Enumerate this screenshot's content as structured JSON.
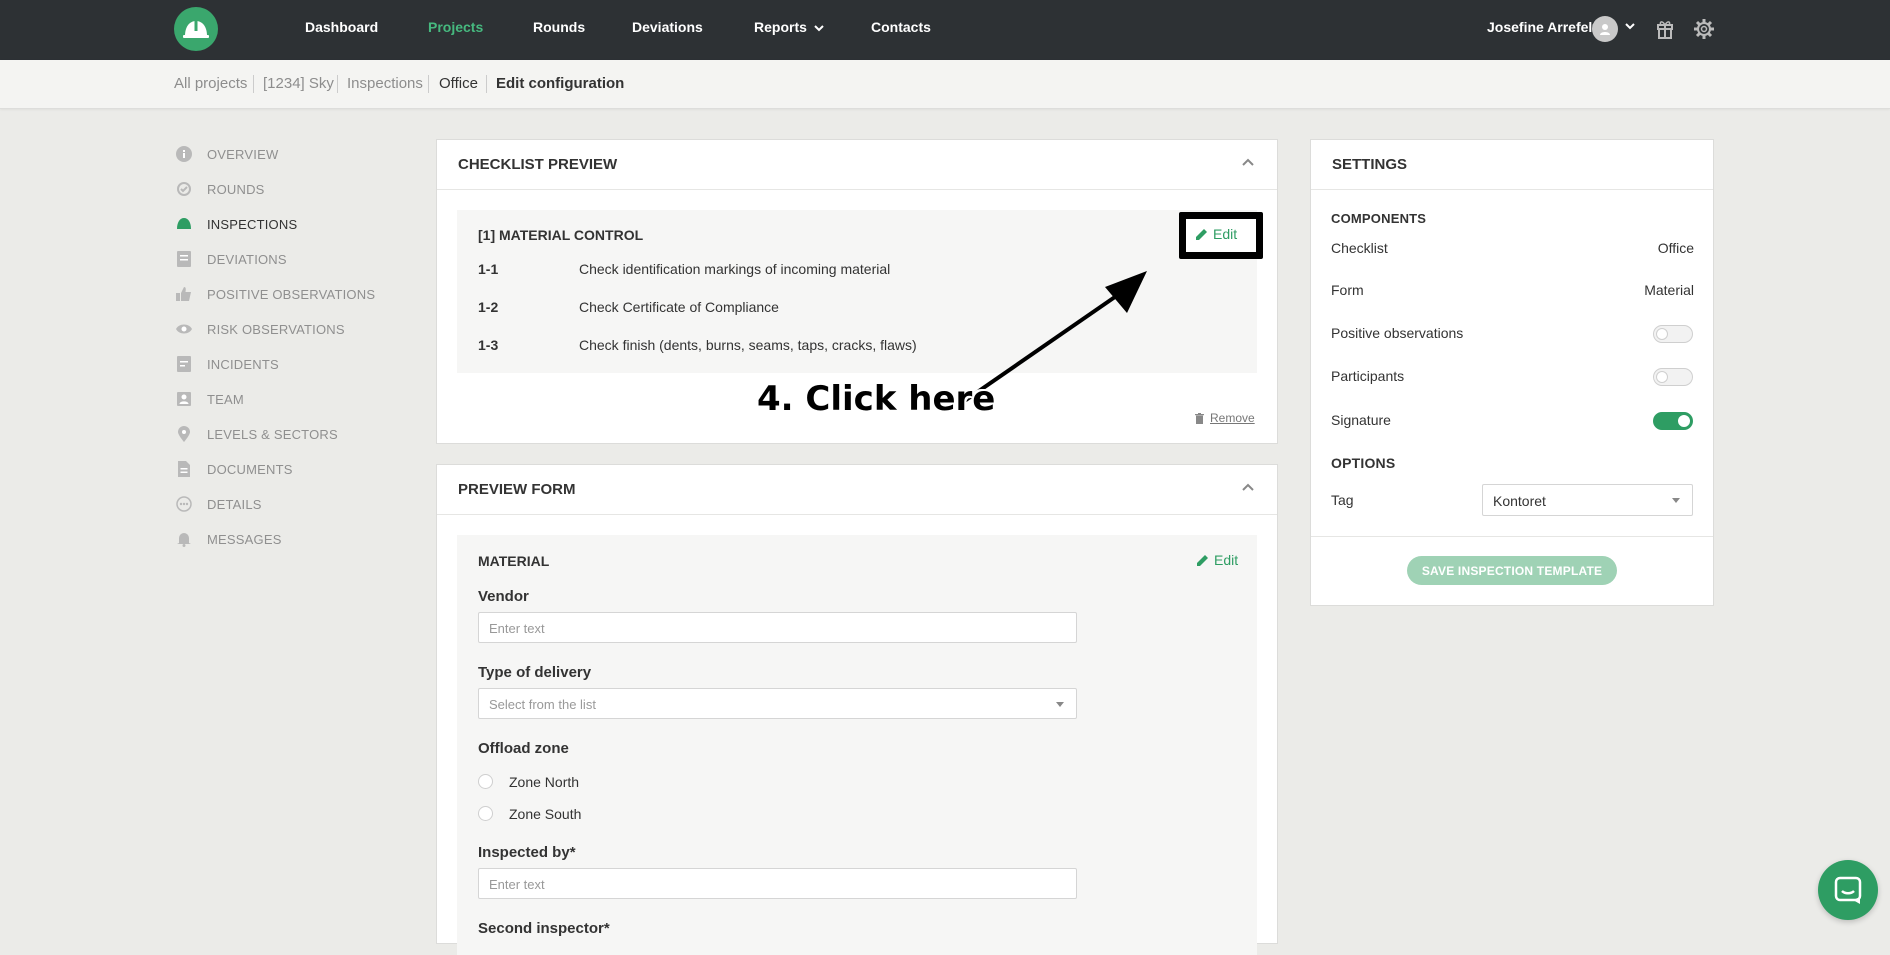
{
  "nav": {
    "items": [
      {
        "label": "Dashboard"
      },
      {
        "label": "Projects"
      },
      {
        "label": "Rounds"
      },
      {
        "label": "Deviations"
      },
      {
        "label": "Reports"
      },
      {
        "label": "Contacts"
      }
    ],
    "user_name": "Josefine Arrefelt",
    "accent_color": "#46b97f"
  },
  "breadcrumb": [
    "All projects",
    "[1234] Sky",
    "Inspections",
    "Office",
    "Edit configuration"
  ],
  "sidebar": {
    "items": [
      {
        "label": "OVERVIEW",
        "icon": "info-icon"
      },
      {
        "label": "ROUNDS",
        "icon": "rounds-icon"
      },
      {
        "label": "INSPECTIONS",
        "icon": "helmet-icon"
      },
      {
        "label": "DEVIATIONS",
        "icon": "deviations-icon"
      },
      {
        "label": "POSITIVE OBSERVATIONS",
        "icon": "thumbs-up-icon"
      },
      {
        "label": "RISK OBSERVATIONS",
        "icon": "eye-icon"
      },
      {
        "label": "INCIDENTS",
        "icon": "incidents-icon"
      },
      {
        "label": "TEAM",
        "icon": "team-icon"
      },
      {
        "label": "LEVELS & SECTORS",
        "icon": "location-pin-icon"
      },
      {
        "label": "DOCUMENTS",
        "icon": "document-icon"
      },
      {
        "label": "DETAILS",
        "icon": "details-icon"
      },
      {
        "label": "MESSAGES",
        "icon": "bell-icon"
      }
    ]
  },
  "checklist": {
    "title": "CHECKLIST PREVIEW",
    "section_title": "[1] MATERIAL CONTROL",
    "edit_label": "Edit",
    "rows": [
      {
        "num": "1-1",
        "text": "Check identification markings of incoming material"
      },
      {
        "num": "1-2",
        "text": "Check Certificate of Compliance"
      },
      {
        "num": "1-3",
        "text": "Check finish (dents, burns, seams, taps, cracks, flaws)"
      }
    ],
    "remove_label": "Remove"
  },
  "annotation": "4. Click here",
  "preview_form": {
    "title": "PREVIEW FORM",
    "section_title": "MATERIAL",
    "edit_label": "Edit",
    "vendor_label": "Vendor",
    "vendor_placeholder": "Enter text",
    "delivery_label": "Type of delivery",
    "delivery_placeholder": "Select from the list",
    "offload_label": "Offload zone",
    "zone_options": [
      "Zone North",
      "Zone South"
    ],
    "inspected_label": "Inspected by*",
    "inspected_placeholder": "Enter text",
    "second_label": "Second inspector*"
  },
  "settings": {
    "title": "SETTINGS",
    "components_label": "COMPONENTS",
    "checklist_label": "Checklist",
    "checklist_value": "Office",
    "form_label": "Form",
    "form_value": "Material",
    "positive_label": "Positive observations",
    "positive_on": false,
    "participants_label": "Participants",
    "participants_on": false,
    "signature_label": "Signature",
    "signature_on": true,
    "options_label": "OPTIONS",
    "tag_label": "Tag",
    "tag_value": "Kontoret",
    "save_label": "SAVE INSPECTION TEMPLATE"
  }
}
